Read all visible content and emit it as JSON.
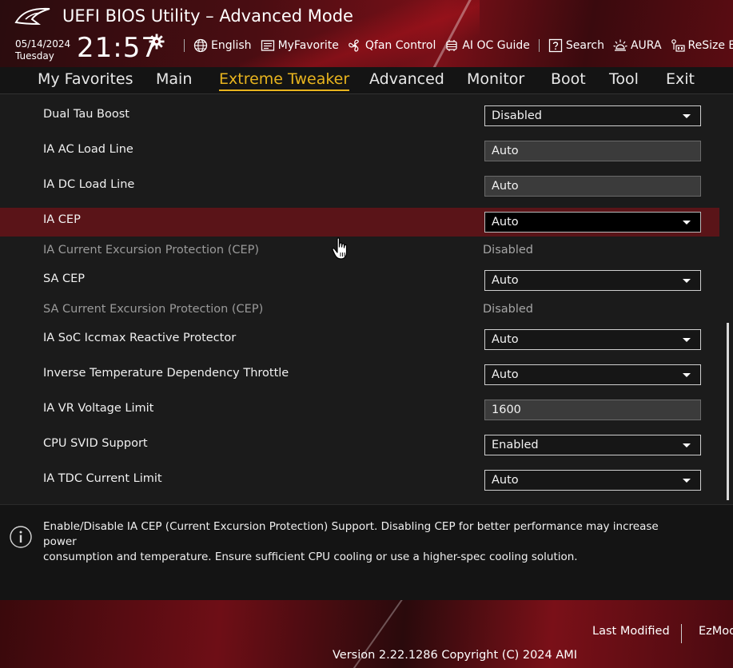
{
  "header": {
    "title": "UEFI BIOS Utility – Advanced Mode",
    "date": "05/14/2024",
    "day": "Tuesday",
    "time": "21:57",
    "tools": [
      {
        "label": "English",
        "icon": "globe-icon"
      },
      {
        "label": "MyFavorite",
        "icon": "favorite-list-icon"
      },
      {
        "label": "Qfan Control",
        "icon": "fan-icon"
      },
      {
        "label": "AI OC Guide",
        "icon": "ai-chip-icon"
      },
      {
        "label": "Search",
        "icon": "question-box-icon"
      },
      {
        "label": "AURA",
        "icon": "aura-light-icon"
      },
      {
        "label": "ReSize BAR",
        "icon": "resize-bar-icon"
      }
    ]
  },
  "nav": {
    "tabs": [
      "My Favorites",
      "Main",
      "Extreme Tweaker",
      "Advanced",
      "Monitor",
      "Boot",
      "Tool",
      "Exit"
    ],
    "active": "Extreme Tweaker"
  },
  "settings": [
    {
      "label": "Dual Tau Boost",
      "type": "dropdown",
      "value": "Disabled"
    },
    {
      "label": "IA AC Load Line",
      "type": "text",
      "value": "Auto"
    },
    {
      "label": "IA DC Load Line",
      "type": "text",
      "value": "Auto"
    },
    {
      "label": "IA CEP",
      "type": "dropdown",
      "value": "Auto",
      "selected": true
    },
    {
      "label": "IA Current Excursion Protection (CEP)",
      "type": "info",
      "value": "Disabled"
    },
    {
      "label": "SA CEP",
      "type": "dropdown",
      "value": "Auto"
    },
    {
      "label": "SA Current Excursion Protection (CEP)",
      "type": "info",
      "value": "Disabled"
    },
    {
      "label": "IA SoC Iccmax Reactive Protector",
      "type": "dropdown",
      "value": "Auto"
    },
    {
      "label": "Inverse Temperature Dependency Throttle",
      "type": "dropdown",
      "value": "Auto"
    },
    {
      "label": "IA VR Voltage Limit",
      "type": "text",
      "value": "1600"
    },
    {
      "label": "CPU SVID Support",
      "type": "dropdown",
      "value": "Enabled"
    },
    {
      "label": "IA TDC Current Limit",
      "type": "dropdown",
      "value": "Auto"
    }
  ],
  "help": {
    "line1": "Enable/Disable IA CEP (Current Excursion Protection) Support. Disabling CEP for better performance may increase power",
    "line2": "consumption and temperature. Ensure sufficient CPU cooling or use a higher-spec cooling solution."
  },
  "footer": {
    "last_modified": "Last Modified",
    "ezmode": "EzMode",
    "version": "Version 2.22.1286 Copyright (C) 2024 AMI"
  },
  "colors": {
    "accent": "#e8b41e",
    "selected_row": "#5a1418",
    "brand_red": "#7a1018"
  }
}
